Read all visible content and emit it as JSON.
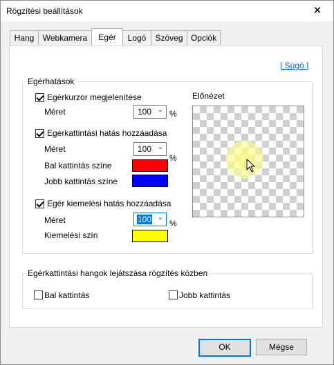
{
  "window": {
    "title": "Rögzítési beállítások",
    "close_symbol": "✕"
  },
  "tabs": [
    {
      "label": "Hang"
    },
    {
      "label": "Webkamera"
    },
    {
      "label": "Egér",
      "active": true
    },
    {
      "label": "Logó"
    },
    {
      "label": "Szöveg"
    },
    {
      "label": "Opciók"
    }
  ],
  "help_link": "[ Súgó ]",
  "mouse_effects": {
    "group_label": "Egérhatások",
    "show_cursor": {
      "label": "Egérkurzor megjelenítése",
      "checked": true,
      "size_label": "Méret",
      "size_value": "100",
      "unit": "%"
    },
    "click_effect": {
      "label": "Egérkattintási hatás hozzáadása",
      "checked": true,
      "size_label": "Méret",
      "size_value": "100",
      "unit": "%",
      "left_label": "Bal kattintás színe",
      "left_color": "#ff0000",
      "right_label": "Jobb kattintás színe",
      "right_color": "#0000ff"
    },
    "highlight_effect": {
      "label": "Egér kiemelési hatás hozzáadása",
      "checked": true,
      "size_label": "Méret",
      "size_value": "100",
      "unit": "%",
      "color_label": "Kiemelési szín",
      "color": "#ffff00"
    },
    "preview_label": "Előnézet"
  },
  "click_sounds": {
    "group_label": "Egérkattintási hangok lejátszása rögzítés közben",
    "left": {
      "label": "Bal kattintás",
      "checked": false
    },
    "right": {
      "label": "Jobb kattintás",
      "checked": false
    }
  },
  "buttons": {
    "ok": "OK",
    "cancel": "Mégse"
  },
  "icons": {
    "dropdown": "chevron-down-icon",
    "close": "close-icon",
    "cursor": "mouse-pointer-icon"
  }
}
